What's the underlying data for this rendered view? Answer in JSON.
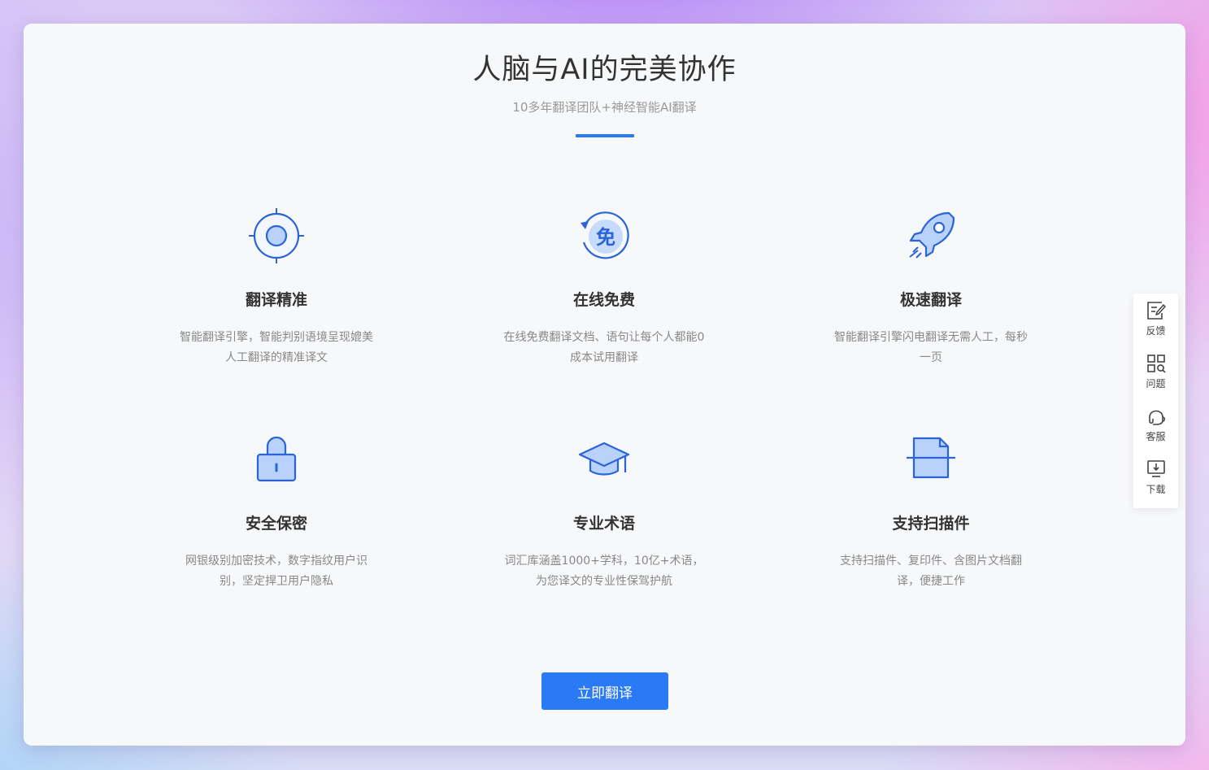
{
  "header": {
    "title": "人脑与AI的完美协作",
    "subtitle": "10多年翻译团队+神经智能AI翻译"
  },
  "features": [
    {
      "icon": "target-icon",
      "title": "翻译精准",
      "desc": "智能翻译引擎，智能判别语境呈现媲美人工翻译的精准译文"
    },
    {
      "icon": "free-refresh-icon",
      "title": "在线免费",
      "badge": "免",
      "desc": "在线免费翻译文档、语句让每个人都能0成本试用翻译"
    },
    {
      "icon": "rocket-icon",
      "title": "极速翻译",
      "desc": "智能翻译引擎闪电翻译无需人工，每秒一页"
    },
    {
      "icon": "lock-icon",
      "title": "安全保密",
      "desc": "网银级别加密技术，数字指纹用户识别，坚定捍卫用户隐私"
    },
    {
      "icon": "graduation-cap-icon",
      "title": "专业术语",
      "desc": "词汇库涵盖1000+学科，10亿+术语，为您译文的专业性保驾护航"
    },
    {
      "icon": "scan-document-icon",
      "title": "支持扫描件",
      "desc": "支持扫描件、复印件、含图片文档翻译，便捷工作"
    }
  ],
  "cta": {
    "label": "立即翻译"
  },
  "sidebar": {
    "items": [
      {
        "icon": "feedback-icon",
        "label": "反馈"
      },
      {
        "icon": "question-grid-icon",
        "label": "问题"
      },
      {
        "icon": "customer-service-icon",
        "label": "客服"
      },
      {
        "icon": "download-icon",
        "label": "下载"
      }
    ]
  },
  "colors": {
    "accent": "#2b7af5",
    "icon_stroke": "#2a64d6",
    "icon_fill": "#b9d2fb",
    "title": "#333333",
    "muted": "#999999"
  }
}
